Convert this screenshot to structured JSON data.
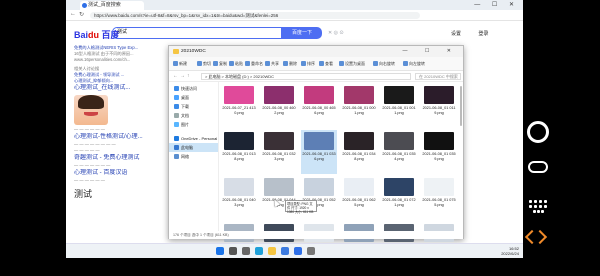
{
  "browser": {
    "tab_title": "测试_百度搜索",
    "window_controls": "— ☐ ✕",
    "url": "https://www.baidu.com/s?ie=utf-8&f=8&rsv_bp=1&rsv_idx=1&tn=baidu&wd=测试&fenlei=256",
    "search_query": "测试",
    "search_button": "百度一下",
    "right_links": [
      "设置",
      "登录"
    ]
  },
  "results": {
    "lines_top": [
      "免费的人格测试NERIS Type Exp...",
      "16型人格测试 由于不同的原因...",
      "www.16personalities.com/ch...",
      ""
    ],
    "section1": "相关人讨论搜",
    "section1_items": [
      "免费心理测试 - 领导测试 ...",
      "心理测试_抑郁倾向..."
    ],
    "title1": "心理测试_在线测试...",
    "title2": "心理测试-性格测试/心理...",
    "title3": "奇趣测试 - 免费心理测试",
    "title4": "心理测试 - 百度汉语",
    "heading_bottom": "测试"
  },
  "explorer": {
    "title": "20210WDC",
    "window_controls": "— ☐ ✕",
    "commands": [
      "新建",
      "剪切",
      "复制",
      "粘贴",
      "重命名",
      "共享",
      "删除",
      "排序",
      "查看",
      "设置为桌面",
      "向右旋转",
      "向左旋转"
    ],
    "path": "> 此电脑 > 本地磁盘 (D:) > 20210WDC",
    "search_placeholder": "在 20210WDC 中搜索",
    "nav_items": [
      {
        "label": "快速访问",
        "color": "#3b8be8"
      },
      {
        "label": "桌面",
        "color": "#4aa3ff"
      },
      {
        "label": "下载",
        "color": "#3b8be8"
      },
      {
        "label": "文档",
        "color": "#9aa"
      },
      {
        "label": "图片",
        "color": "#59b6ff"
      },
      {
        "label": "OneDrive - Personal",
        "color": "#1e7be0"
      },
      {
        "label": "此电脑",
        "color": "#3578d0"
      },
      {
        "label": "网络",
        "color": "#5a8fd0"
      }
    ],
    "files": [
      {
        "name": "2021-06-07_21 4130.png",
        "color": "#e04a9a"
      },
      {
        "name": "2021-06-08_00 4602.png",
        "color": "#8c2f6d"
      },
      {
        "name": "2021-06-08_00 4656.png",
        "color": "#c23b7e"
      },
      {
        "name": "2021-06-08_01 0001.png",
        "color": "#a2386a"
      },
      {
        "name": "2021-06-08_01 0011.png",
        "color": "#1a1a1a"
      },
      {
        "name": "2021-06-08_01 0119.png",
        "color": "#2b1c2a"
      },
      {
        "name": "2021-06-08_01 0138.png",
        "color": "#1c2433"
      },
      {
        "name": "2021-06-08_01 0323.png",
        "color": "#3a3036"
      },
      {
        "name": "2021-06-08_01 0336.png",
        "color": "#5d7fb5"
      },
      {
        "name": "2021-06-08_01 0348.png",
        "color": "#2a2327"
      },
      {
        "name": "2021-06-08_01 0354.png",
        "color": "#4c4c52"
      },
      {
        "name": "2021-06-08_01 0359.png",
        "color": "#111111"
      },
      {
        "name": "2021-06-08_01 0403.png",
        "color": "#d7dde6"
      },
      {
        "name": "2021-06-08_01 0441.png",
        "color": "#b7c0ca"
      },
      {
        "name": "2021-06-08_01 0523.png",
        "color": "#c8d2de"
      },
      {
        "name": "2021-06-08_01 0625.png",
        "color": "#e9eef4"
      },
      {
        "name": "2021-06-08_01 0721.png",
        "color": "#2d4466"
      },
      {
        "name": "2021-06-08_01 0755.png",
        "color": "#eef2f5"
      },
      {
        "name": "2021-06-08_01 0812.png",
        "color": "#aab6c4"
      },
      {
        "name": "2021-06-08_01 0830.png",
        "color": "#3f4a5a"
      },
      {
        "name": "2021-06-08_01 0855.png",
        "color": "#dfe5eb"
      },
      {
        "name": "2021-06-08_01 0912.png",
        "color": "#8fa2b8"
      },
      {
        "name": "2021-06-08_01 0933.png",
        "color": "#5a6472"
      },
      {
        "name": "2021-06-08_01 0950.png",
        "color": "#cfd7e0"
      }
    ],
    "tooltip": "项目类型: PNG 文件 尺寸: 1920 x 1080 大小: 611 KB",
    "status": "176 个项目  选中 1 个项目 (611 KB)"
  },
  "taskbar": {
    "time": "16:52",
    "date": "2022/6/24",
    "icons": [
      {
        "name": "windows-start-icon",
        "color": "#1a73e8"
      },
      {
        "name": "search-icon",
        "color": "#555"
      },
      {
        "name": "task-view-icon",
        "color": "#666"
      },
      {
        "name": "edge-icon",
        "color": "#1fa0d9"
      },
      {
        "name": "file-explorer-icon",
        "color": "#f5c542"
      },
      {
        "name": "store-icon",
        "color": "#3d7be0"
      },
      {
        "name": "mail-icon",
        "color": "#2e6fe7"
      },
      {
        "name": "settings-icon",
        "color": "#777"
      }
    ]
  }
}
